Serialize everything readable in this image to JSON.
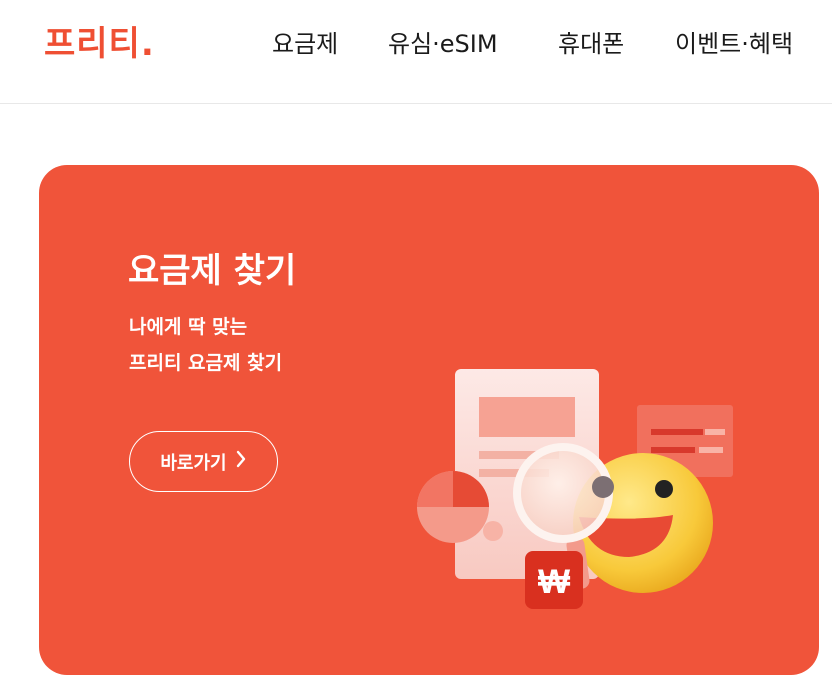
{
  "header": {
    "logo": "프리티.",
    "nav": [
      {
        "label": "요금제"
      },
      {
        "label": "유심·eSIM"
      },
      {
        "label": "휴대폰"
      },
      {
        "label": "이벤트·혜택"
      }
    ]
  },
  "banner": {
    "title": "요금제 찾기",
    "subtitle_line1": "나에게 딱 맞는",
    "subtitle_line2": "프리티 요금제 찾기",
    "cta_label": "바로가기",
    "illustration_currency": "₩"
  },
  "colors": {
    "brand": "#ef4f33",
    "banner_bg": "#f0543a",
    "text_dark": "#1b1b1b"
  }
}
